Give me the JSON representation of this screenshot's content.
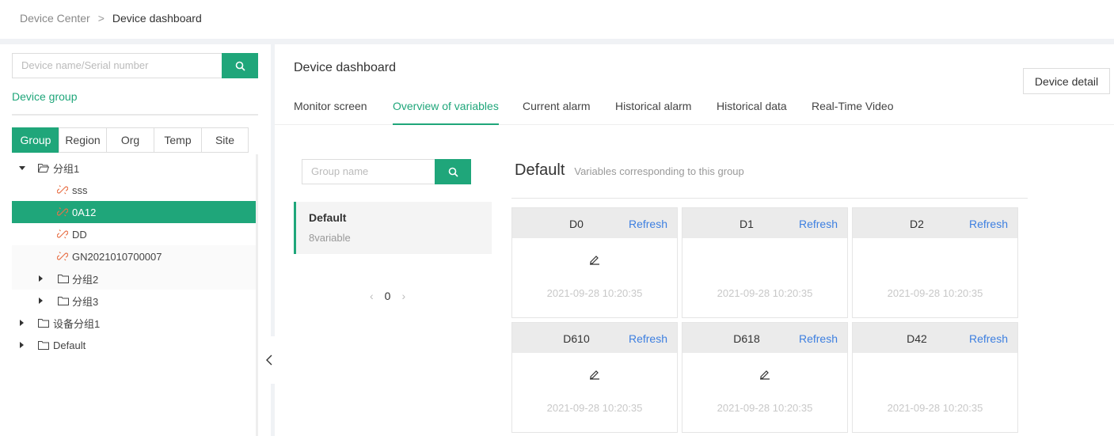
{
  "breadcrumb": {
    "parent": "Device Center",
    "separator": ">",
    "current": "Device dashboard"
  },
  "left": {
    "search_placeholder": "Device name/Serial number",
    "group_label": "Device group",
    "segments": [
      "Group",
      "Region",
      "Org",
      "Temp",
      "Site"
    ],
    "tree": [
      {
        "label": "分组1",
        "type": "folder",
        "expanded": true
      },
      {
        "label": "sss",
        "type": "device"
      },
      {
        "label": "0A12",
        "type": "device",
        "selected": true
      },
      {
        "label": "DD",
        "type": "device"
      },
      {
        "label": "GN2021010700007",
        "type": "device"
      },
      {
        "label": "分组2",
        "type": "folder"
      },
      {
        "label": "分组3",
        "type": "folder"
      },
      {
        "label": "设备分组1",
        "type": "folder"
      },
      {
        "label": "Default",
        "type": "folder"
      }
    ]
  },
  "main": {
    "title": "Device dashboard",
    "detail_button": "Device detail",
    "tabs": [
      "Monitor screen",
      "Overview of variables",
      "Current alarm",
      "Historical alarm",
      "Historical data",
      "Real-Time Video"
    ],
    "active_tab": "Overview of variables",
    "group_search_placeholder": "Group name",
    "group_item": {
      "name": "Default",
      "count": "8variable"
    },
    "pager": {
      "page": "0"
    },
    "group_header": {
      "name": "Default",
      "desc": "Variables corresponding to this group"
    },
    "refresh_label": "Refresh",
    "cards": [
      {
        "name": "D0",
        "time": "2021-09-28 10:20:35",
        "editable": true
      },
      {
        "name": "D1",
        "time": "2021-09-28 10:20:35",
        "editable": false
      },
      {
        "name": "D2",
        "time": "2021-09-28 10:20:35",
        "editable": false
      },
      {
        "name": "D610",
        "time": "2021-09-28 10:20:35",
        "editable": true
      },
      {
        "name": "D618",
        "time": "2021-09-28 10:20:35",
        "editable": true
      },
      {
        "name": "D42",
        "time": "2021-09-28 10:20:35",
        "editable": false
      }
    ]
  },
  "colors": {
    "accent": "#1fa67a",
    "link": "#3d7fe0",
    "device_icon": "#e8734a"
  }
}
